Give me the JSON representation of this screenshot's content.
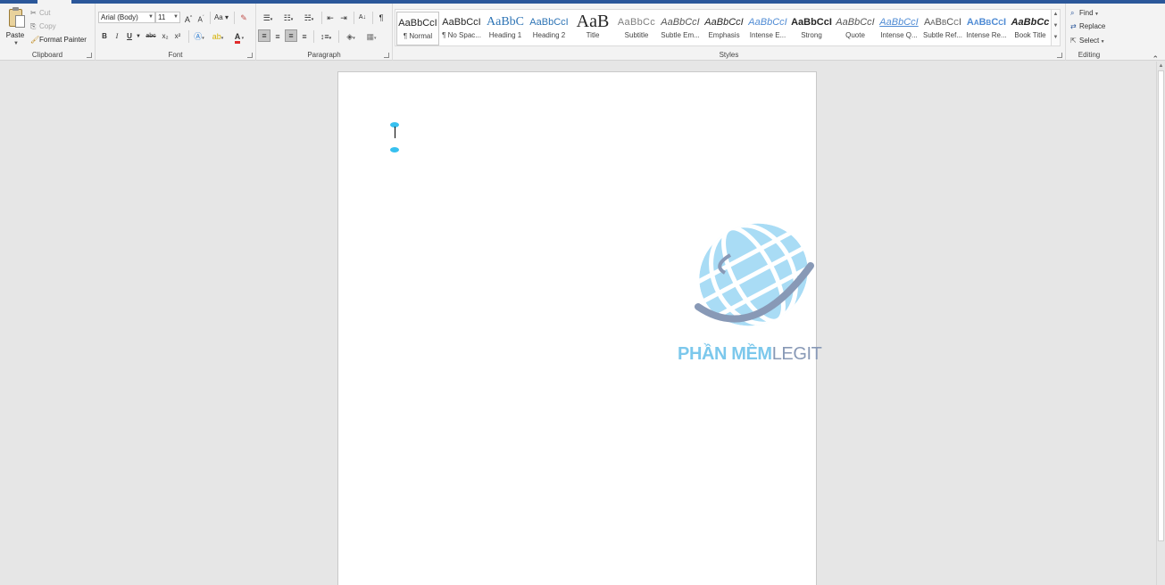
{
  "colors": {
    "accent": "#2b579a",
    "watermark_blue": "#7cc8ec",
    "watermark_gray": "#8899b6",
    "selection_handle": "#37c0ef"
  },
  "clipboard": {
    "label": "Clipboard",
    "paste_label": "Paste",
    "cut_label": "Cut",
    "copy_label": "Copy",
    "format_painter_label": "Format Painter"
  },
  "font": {
    "label": "Font",
    "font_name": "Arial (Body)",
    "font_size": "11",
    "change_case_label": "Aa",
    "bold_label": "B",
    "italic_label": "I",
    "underline_label": "U",
    "strike_label": "abc",
    "subscript_label": "x₂",
    "superscript_label": "x²",
    "font_color_label": "A"
  },
  "paragraph": {
    "label": "Paragraph",
    "sort_label": "A↓",
    "pilcrow_label": "¶"
  },
  "styles": {
    "label": "Styles",
    "items": [
      {
        "preview": "AaBbCcI",
        "name": "¶ Normal"
      },
      {
        "preview": "AaBbCcI",
        "name": "¶ No Spac..."
      },
      {
        "preview": "AaBbC",
        "name": "Heading 1"
      },
      {
        "preview": "AaBbCcI",
        "name": "Heading 2"
      },
      {
        "preview": "AaB",
        "name": "Title"
      },
      {
        "preview": "AaBbCc",
        "name": "Subtitle"
      },
      {
        "preview": "AaBbCcI",
        "name": "Subtle Em..."
      },
      {
        "preview": "AaBbCcI",
        "name": "Emphasis"
      },
      {
        "preview": "AaBbCcI",
        "name": "Intense E..."
      },
      {
        "preview": "AaBbCcI",
        "name": "Strong"
      },
      {
        "preview": "AaBbCcI",
        "name": "Quote"
      },
      {
        "preview": "AaBbCcI",
        "name": "Intense Q..."
      },
      {
        "preview": "AaBbCcI",
        "name": "Subtle Ref..."
      },
      {
        "preview": "AaBbCcI",
        "name": "Intense Re..."
      },
      {
        "preview": "AaBbCc",
        "name": "Book Title"
      }
    ]
  },
  "editing": {
    "label": "Editing",
    "find_label": "Find",
    "replace_label": "Replace",
    "select_label": "Select"
  },
  "watermark": {
    "text_bold": "PHẦN MỀM",
    "text_light": "LEGIT"
  }
}
